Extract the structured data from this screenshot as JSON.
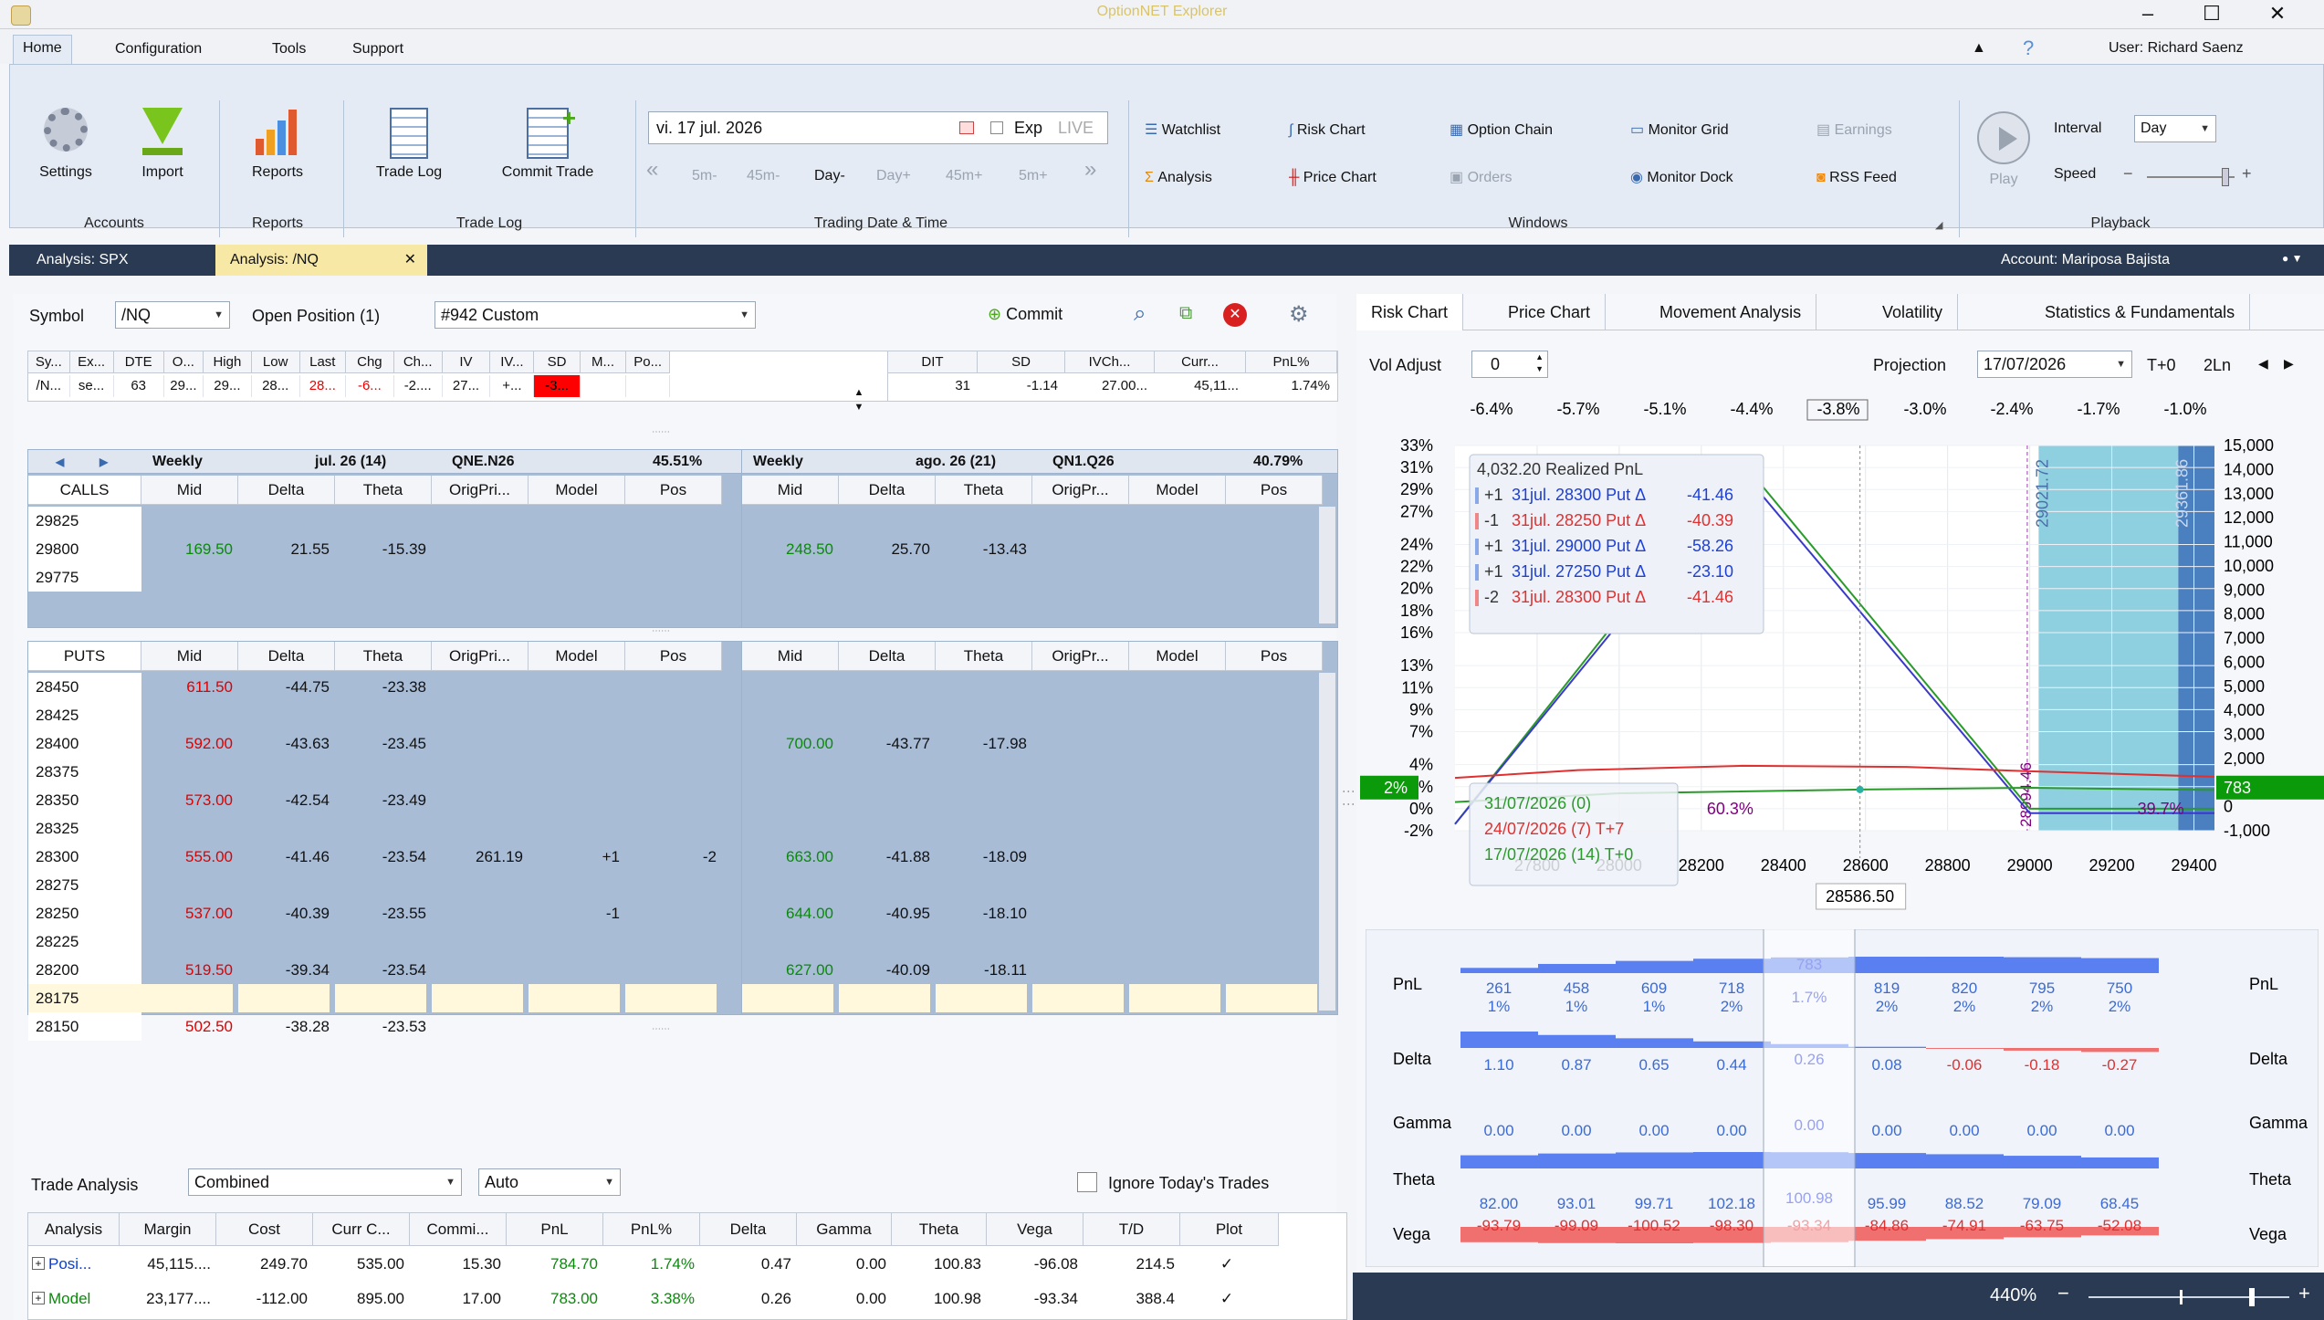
{
  "app": {
    "title": "OptionNET Explorer",
    "user": "User: Richard Saenz"
  },
  "menu": [
    "Home",
    "Configuration",
    "Tools",
    "Support"
  ],
  "ribbon": {
    "accounts": {
      "settings": "Settings",
      "import": "Import",
      "title": "Accounts"
    },
    "reports": {
      "reports": "Reports",
      "title": "Reports"
    },
    "tradelog": {
      "trade_log": "Trade Log",
      "commit_trade": "Commit Trade",
      "title": "Trade Log"
    },
    "trading": {
      "date": "vi. 17 jul. 2026",
      "exp": "Exp",
      "live": "LIVE",
      "steps": [
        "5m-",
        "45m-",
        "Day-",
        "Day+",
        "45m+",
        "5m+"
      ],
      "title": "Trading Date & Time"
    },
    "windows": {
      "watchlist": "Watchlist",
      "analysis": "Analysis",
      "risk_chart": "Risk Chart",
      "price_chart": "Price Chart",
      "option_chain": "Option Chain",
      "orders": "Orders",
      "monitor_grid": "Monitor Grid",
      "monitor_dock": "Monitor Dock",
      "earnings": "Earnings",
      "rss_feed": "RSS Feed",
      "title": "Windows"
    },
    "playback": {
      "play": "Play",
      "interval_label": "Interval",
      "interval": "Day",
      "speed_label": "Speed",
      "title": "Playback"
    }
  },
  "doctabs": {
    "tab1": "Analysis: SPX",
    "tab2": "Analysis: /NQ",
    "account": "Account: Mariposa Bajista"
  },
  "position": {
    "symbol_label": "Symbol",
    "symbol": "/NQ",
    "open_label": "Open Position (1)",
    "open": "#942 Custom",
    "commit": "Commit"
  },
  "quote": {
    "headers": [
      "Sy...",
      "Ex...",
      "DTE",
      "O...",
      "High",
      "Low",
      "Last",
      "Chg",
      "Ch...",
      "IV",
      "IV...",
      "SD",
      "M...",
      "Po..."
    ],
    "values": [
      "/N...",
      "se...",
      "63",
      "29...",
      "29...",
      "28...",
      "28...",
      "-6...",
      "-2....",
      "27...",
      "+...",
      "-3...",
      "",
      ""
    ]
  },
  "stats": {
    "headers": [
      "DIT",
      "SD",
      "IVCh...",
      "Curr...",
      "PnL%"
    ],
    "values": [
      "31",
      "-1.14",
      "27.00...",
      "45,11...",
      "1.74%"
    ]
  },
  "chain": {
    "left_header": {
      "weekly": "Weekly",
      "date": "jul. 26 (14)",
      "code": "QNE.N26",
      "pct": "45.51%"
    },
    "right_header": {
      "weekly": "Weekly",
      "date": "ago. 26 (21)",
      "code": "QN1.Q26",
      "pct": "40.79%"
    },
    "calls_label": "CALLS",
    "puts_label": "PUTS",
    "cols_left": [
      "Mid",
      "Delta",
      "Theta",
      "OrigPri...",
      "Model",
      "Pos"
    ],
    "cols_right": [
      "Mid",
      "Delta",
      "Theta",
      "OrigPr...",
      "Model",
      "Pos"
    ],
    "calls": [
      {
        "strike": "29825",
        "l": [
          "",
          "",
          "",
          "",
          "",
          ""
        ],
        "r": [
          "",
          "",
          "",
          "",
          "",
          ""
        ]
      },
      {
        "strike": "29800",
        "l": [
          "169.50",
          "21.55",
          "-15.39",
          "",
          "",
          ""
        ],
        "r": [
          "248.50",
          "25.70",
          "-13.43",
          "",
          "",
          ""
        ]
      },
      {
        "strike": "29775",
        "l": [
          "",
          "",
          "",
          "",
          "",
          ""
        ],
        "r": [
          "",
          "",
          "",
          "",
          "",
          ""
        ]
      }
    ],
    "puts": [
      {
        "strike": "28450",
        "l": [
          "611.50",
          "-44.75",
          "-23.38",
          "",
          "",
          ""
        ],
        "r": [
          "",
          "",
          "",
          "",
          "",
          ""
        ]
      },
      {
        "strike": "28425",
        "l": [
          "",
          "",
          "",
          "",
          "",
          ""
        ],
        "r": [
          "",
          "",
          "",
          "",
          "",
          ""
        ]
      },
      {
        "strike": "28400",
        "l": [
          "592.00",
          "-43.63",
          "-23.45",
          "",
          "",
          ""
        ],
        "r": [
          "700.00",
          "-43.77",
          "-17.98",
          "",
          "",
          ""
        ]
      },
      {
        "strike": "28375",
        "l": [
          "",
          "",
          "",
          "",
          "",
          ""
        ],
        "r": [
          "",
          "",
          "",
          "",
          "",
          ""
        ]
      },
      {
        "strike": "28350",
        "l": [
          "573.00",
          "-42.54",
          "-23.49",
          "",
          "",
          ""
        ],
        "r": [
          "",
          "",
          "",
          "",
          "",
          ""
        ]
      },
      {
        "strike": "28325",
        "l": [
          "",
          "",
          "",
          "",
          "",
          ""
        ],
        "r": [
          "",
          "",
          "",
          "",
          "",
          ""
        ]
      },
      {
        "strike": "28300",
        "l": [
          "555.00",
          "-41.46",
          "-23.54",
          "261.19",
          "+1",
          "-2"
        ],
        "r": [
          "663.00",
          "-41.88",
          "-18.09",
          "",
          "",
          ""
        ]
      },
      {
        "strike": "28275",
        "l": [
          "",
          "",
          "",
          "",
          "",
          ""
        ],
        "r": [
          "",
          "",
          "",
          "",
          "",
          ""
        ]
      },
      {
        "strike": "28250",
        "l": [
          "537.00",
          "-40.39",
          "-23.55",
          "",
          "-1",
          ""
        ],
        "r": [
          "644.00",
          "-40.95",
          "-18.10",
          "",
          "",
          ""
        ]
      },
      {
        "strike": "28225",
        "l": [
          "",
          "",
          "",
          "",
          "",
          ""
        ],
        "r": [
          "",
          "",
          "",
          "",
          "",
          ""
        ]
      },
      {
        "strike": "28200",
        "l": [
          "519.50",
          "-39.34",
          "-23.54",
          "",
          "",
          ""
        ],
        "r": [
          "627.00",
          "-40.09",
          "-18.11",
          "",
          "",
          ""
        ]
      },
      {
        "strike": "28175",
        "l": [
          "",
          "",
          "",
          "",
          "",
          ""
        ],
        "r": [
          "",
          "",
          "",
          "",
          "",
          ""
        ]
      },
      {
        "strike": "28150",
        "l": [
          "502.50",
          "-38.28",
          "-23.53",
          "",
          "",
          ""
        ],
        "r": [
          "",
          "",
          "",
          "",
          "",
          ""
        ]
      }
    ]
  },
  "trade_analysis": {
    "label": "Trade Analysis",
    "mode": "Combined",
    "auto": "Auto",
    "ignore": "Ignore Today's Trades",
    "headers": [
      "Analysis",
      "Margin",
      "Cost",
      "Curr C...",
      "Commi...",
      "PnL",
      "PnL%",
      "Delta",
      "Gamma",
      "Theta",
      "Vega",
      "T/D",
      "Plot"
    ],
    "rows": [
      [
        "Posi...",
        "45,115....",
        "249.70",
        "535.00",
        "15.30",
        "784.70",
        "1.74%",
        "0.47",
        "0.00",
        "100.83",
        "-96.08",
        "214.5",
        "✓"
      ],
      [
        "Model",
        "23,177....",
        "-112.00",
        "895.00",
        "17.00",
        "783.00",
        "3.38%",
        "0.26",
        "0.00",
        "100.98",
        "-93.34",
        "388.4",
        "✓"
      ]
    ]
  },
  "chart_tabs": [
    "Risk Chart",
    "Price Chart",
    "Movement Analysis",
    "Volatility",
    "Statistics & Fundamentals"
  ],
  "chart_toolbar": {
    "vol_label": "Vol Adjust",
    "vol": "0",
    "proj_label": "Projection",
    "proj": "17/07/2026",
    "t0": "T+0",
    "ln": "2Ln"
  },
  "chart_data": {
    "type": "line",
    "x_ticks": [
      "27800",
      "28000",
      "28200",
      "28400",
      "28600",
      "28800",
      "29000",
      "29200",
      "29400"
    ],
    "y_left_ticks": [
      "33%",
      "31%",
      "29%",
      "27%",
      "24%",
      "22%",
      "20%",
      "18%",
      "16%",
      "13%",
      "11%",
      "9%",
      "7%",
      "4%",
      "2%",
      "0%",
      "-2%"
    ],
    "y_right_ticks": [
      "15,000",
      "14,000",
      "13,000",
      "12,000",
      "11,000",
      "10,000",
      "9,000",
      "8,000",
      "7,000",
      "6,000",
      "5,000",
      "4,000",
      "3,000",
      "2,000",
      "1,000",
      "0",
      "-1,000"
    ],
    "top_pcts": [
      "-6.4%",
      "-5.7%",
      "-5.1%",
      "-4.4%",
      "-3.8%",
      "-3.0%",
      "-2.4%",
      "-1.7%",
      "-1.0%"
    ],
    "current_price": "28586.50",
    "current_pnl_left": "2%",
    "current_pnl_right": "783",
    "band_left": "29021.72",
    "band_right": "29361.86",
    "be": "28994.46",
    "pct_a": "60.3%",
    "pct_b": "39.7%",
    "legend_top": {
      "realized": "4,032.20 Realized PnL",
      "items": [
        {
          "q": "+1",
          "text": "31jul. 28300 Put Δ",
          "val": "-41.46",
          "color": "#1d3fd6"
        },
        {
          "q": "-1",
          "text": "31jul. 28250 Put Δ",
          "val": "-40.39",
          "color": "#e03030"
        },
        {
          "q": "+1",
          "text": "31jul. 29000 Put Δ",
          "val": "-58.26",
          "color": "#1d3fd6"
        },
        {
          "q": "+1",
          "text": "31jul. 27250 Put Δ",
          "val": "-23.10",
          "color": "#1d3fd6"
        },
        {
          "q": "-2",
          "text": "31jul. 28300 Put Δ",
          "val": "-41.46",
          "color": "#e03030"
        }
      ]
    },
    "legend_dates": [
      {
        "text": "31/07/2026 (0)",
        "color": "#2a9a2a"
      },
      {
        "text": "24/07/2026 (7) T+7",
        "color": "#e03030"
      },
      {
        "text": "17/07/2026 (14) T+0",
        "color": "#2a9a2a"
      }
    ],
    "series": [
      {
        "name": "31/07/2026 (0)",
        "color": "#2a9a2a",
        "x": [
          27600,
          28300,
          29000,
          29450
        ],
        "y": [
          -1.4,
          31.5,
          0,
          0
        ]
      },
      {
        "name": "",
        "color": "#3a3ac8",
        "x": [
          27600,
          28300,
          29000,
          29450
        ],
        "y": [
          -1.4,
          30.6,
          -0.4,
          -0.4
        ]
      },
      {
        "name": "24/07/2026 (7) T+7",
        "color": "#e03030",
        "x": [
          27600,
          27900,
          28300,
          28700,
          29000,
          29450
        ],
        "y": [
          2.8,
          3.5,
          3.9,
          3.8,
          3.4,
          2.9
        ]
      },
      {
        "name": "17/07/2026 (14) T+0",
        "color": "#2a9a2a",
        "x": [
          27600,
          28000,
          28586.5,
          29000,
          29450
        ],
        "y": [
          0.6,
          1.4,
          1.74,
          1.9,
          1.7
        ]
      }
    ]
  },
  "greeks": {
    "labels": [
      "PnL",
      "Delta",
      "Gamma",
      "Theta",
      "Vega"
    ],
    "pnl": [
      [
        "261",
        "1%"
      ],
      [
        "458",
        "1%"
      ],
      [
        "609",
        "1%"
      ],
      [
        "718",
        "2%"
      ],
      [
        "783",
        "1.7%"
      ],
      [
        "819",
        "2%"
      ],
      [
        "820",
        "2%"
      ],
      [
        "795",
        "2%"
      ],
      [
        "750",
        "2%"
      ]
    ],
    "delta": [
      "1.10",
      "0.87",
      "0.65",
      "0.44",
      "0.26",
      "0.08",
      "-0.06",
      "-0.18",
      "-0.27"
    ],
    "gamma": [
      "0.00",
      "0.00",
      "0.00",
      "0.00",
      "0.00",
      "0.00",
      "0.00",
      "0.00",
      "0.00"
    ],
    "theta": [
      "82.00",
      "93.01",
      "99.71",
      "102.18",
      "100.98",
      "95.99",
      "88.52",
      "79.09",
      "68.45"
    ],
    "vega": [
      "-93.79",
      "-99.09",
      "-100.52",
      "-98.30",
      "-93.34",
      "-84.86",
      "-74.91",
      "-63.75",
      "-52.08"
    ]
  },
  "zoom": "440%"
}
